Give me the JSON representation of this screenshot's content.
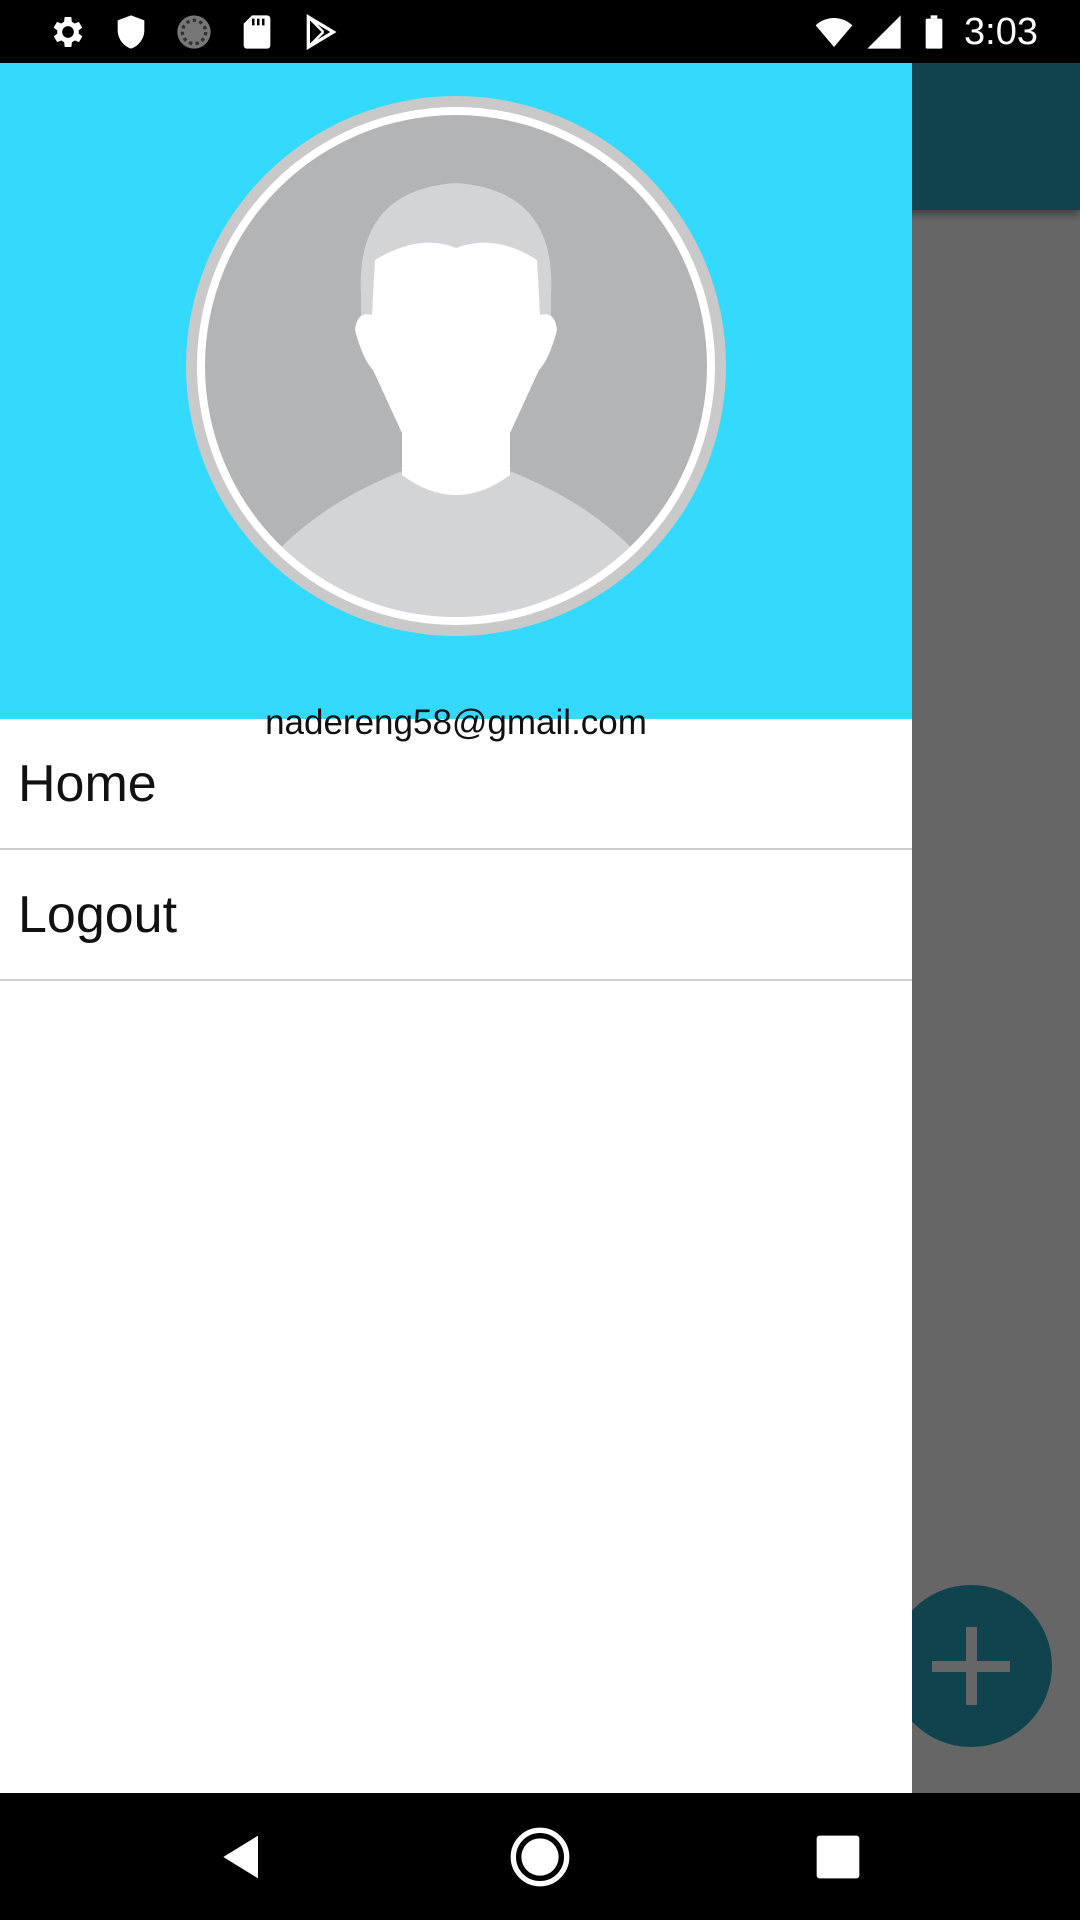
{
  "status_bar": {
    "time": "3:03",
    "left_icons": [
      "settings-icon",
      "shield-icon",
      "sync-icon",
      "sd-card-icon",
      "play-store-icon"
    ],
    "right_icons": [
      "wifi-icon",
      "cell-signal-icon",
      "battery-icon"
    ]
  },
  "drawer": {
    "header": {
      "avatar": "default-person-avatar",
      "email": "nadereng58@gmail.com",
      "background_color": "#33dafd"
    },
    "menu": [
      {
        "label": "Home"
      },
      {
        "label": "Logout"
      }
    ]
  },
  "app_behind": {
    "toolbar_color": "#2aa9c2",
    "fab_icon": "plus-icon"
  },
  "nav_bar": {
    "buttons": [
      "back-icon",
      "home-icon",
      "recents-icon"
    ]
  }
}
